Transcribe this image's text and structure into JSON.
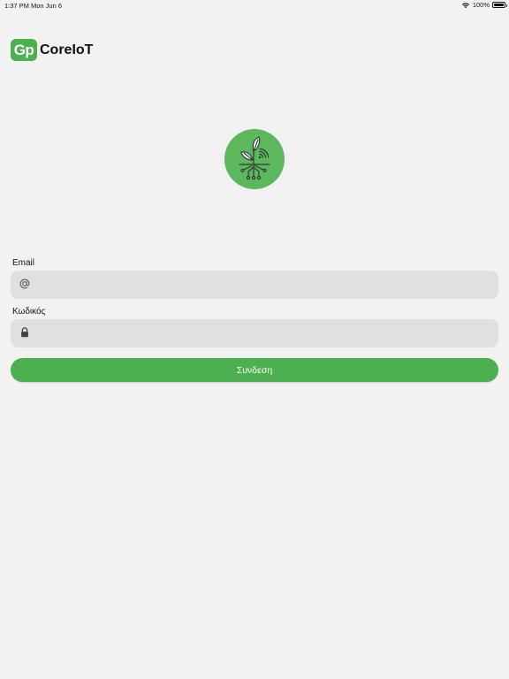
{
  "status_bar": {
    "time": "1:37 PM",
    "date": "Mon Jun 6",
    "battery": "100%"
  },
  "brand": {
    "logo_text": "Gp",
    "name": "CoreIoT"
  },
  "form": {
    "email_label": "Email",
    "email_value": "",
    "email_placeholder": "",
    "password_label": "Κωδικός",
    "password_value": "",
    "password_placeholder": "",
    "submit_label": "Συνδεση"
  },
  "colors": {
    "accent": "#4caf50",
    "logo_circle": "#5cb85c",
    "field_bg": "#e0e0e0",
    "background": "#f2f2f2"
  },
  "icons": {
    "email": "at-icon",
    "password": "lock-icon",
    "logo": "plant-iot-icon"
  }
}
